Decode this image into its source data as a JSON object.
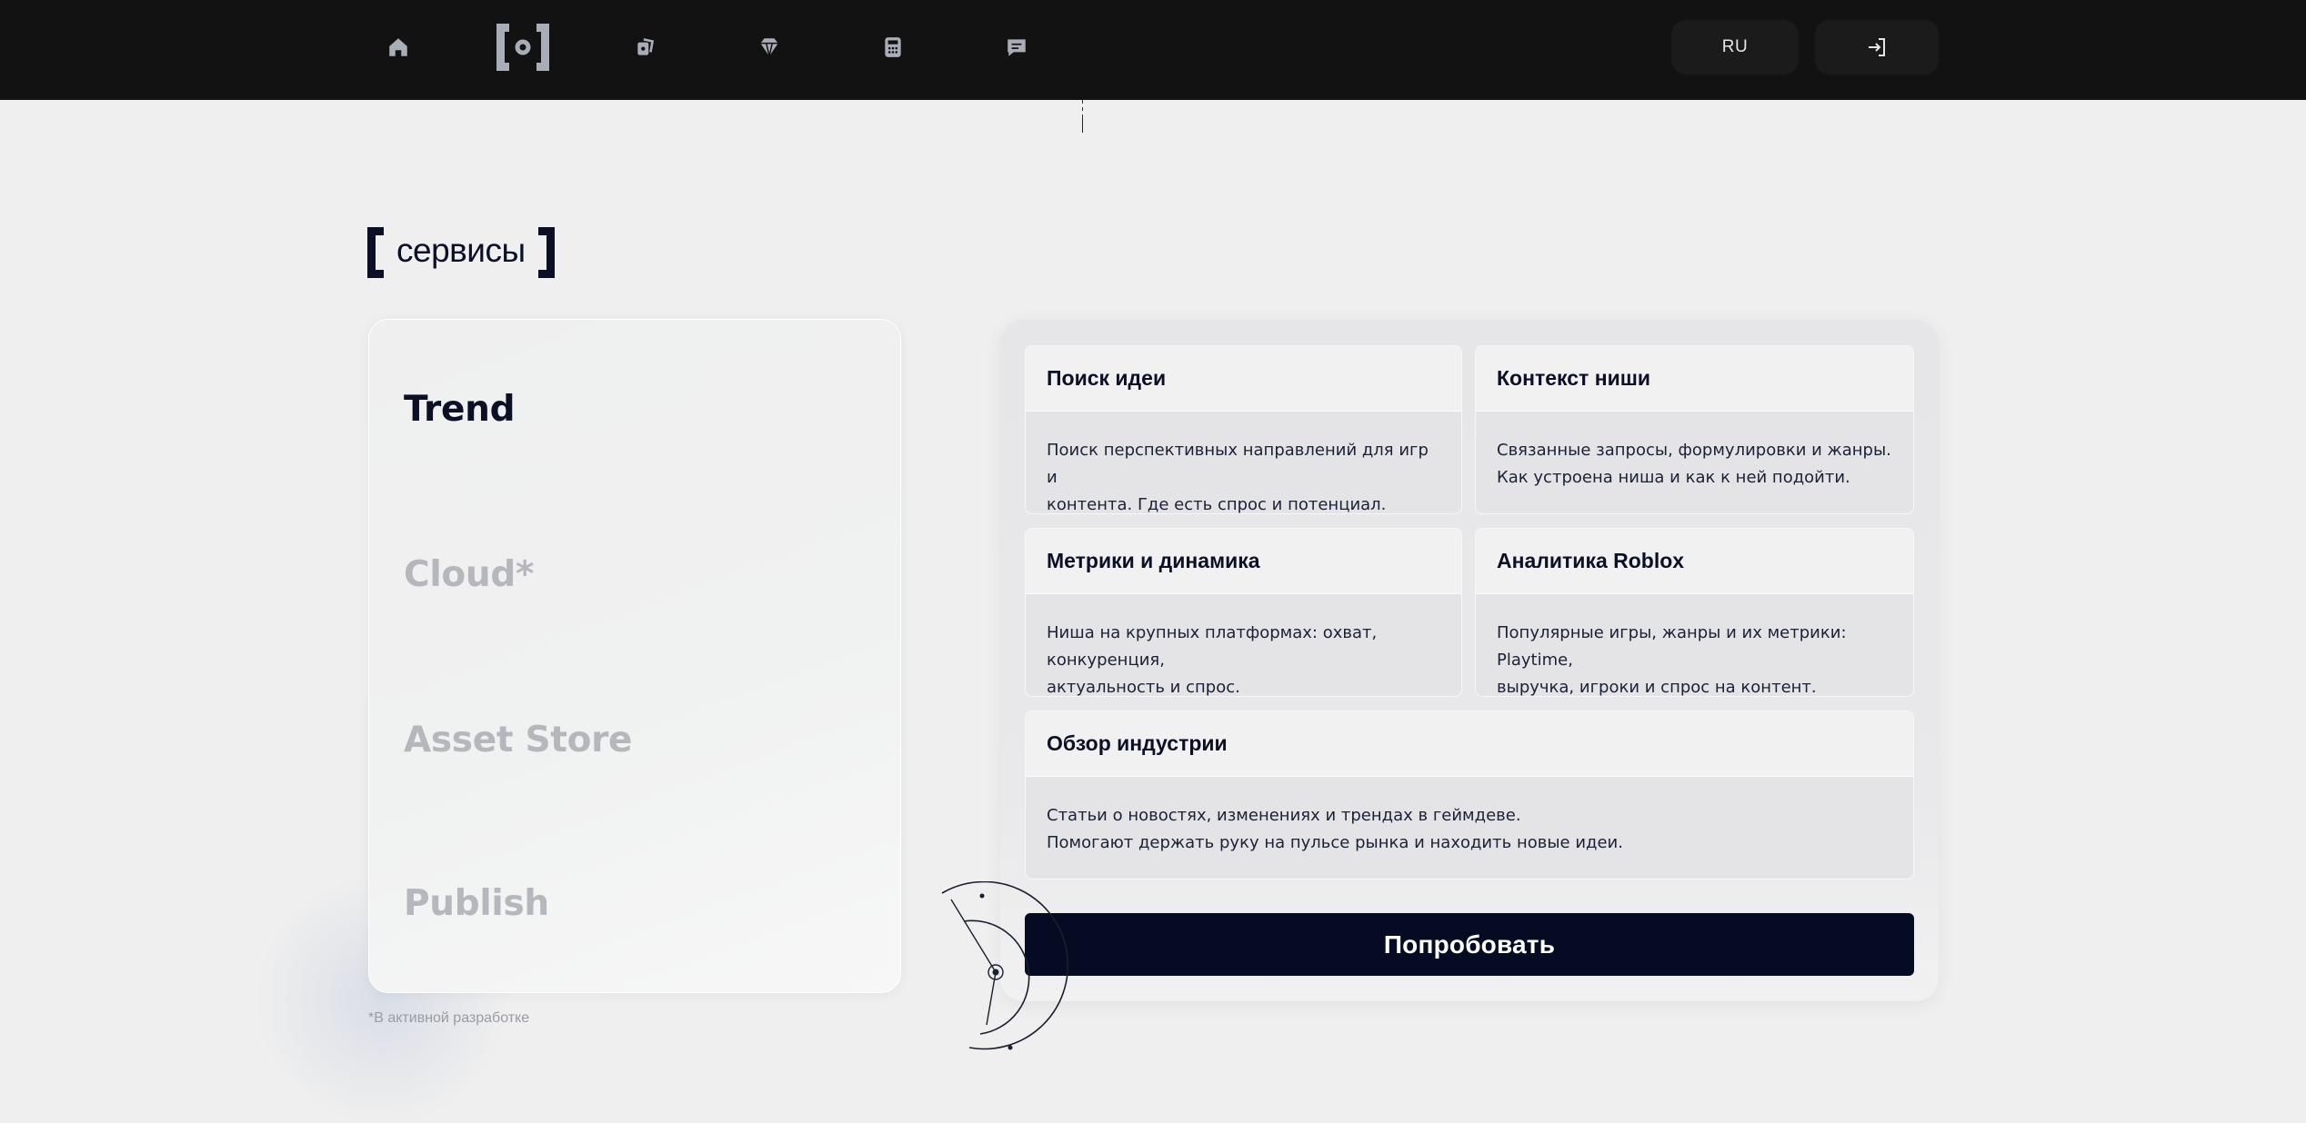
{
  "nav": {
    "items": [
      {
        "icon": "home-icon"
      },
      {
        "icon": "logo-icon"
      },
      {
        "icon": "cards-icon"
      },
      {
        "icon": "diamond-icon"
      },
      {
        "icon": "calculator-icon"
      },
      {
        "icon": "chat-icon"
      }
    ],
    "lang_label": "RU",
    "login_icon": "login-icon"
  },
  "section": {
    "title": "сервисы"
  },
  "left_panel": {
    "items": [
      {
        "label": "Trend",
        "state": "active"
      },
      {
        "label": "Cloud*",
        "state": "inactive"
      },
      {
        "label": "Asset Store",
        "state": "inactive"
      },
      {
        "label": "Publish",
        "state": "inactive"
      }
    ],
    "note": "*В активной разработке"
  },
  "cards": [
    {
      "title": "Поиск идеи",
      "lines": [
        "Поиск перспективных направлений для игр и",
        "контента. Где есть спрос и потенциал."
      ]
    },
    {
      "title": "Контекст ниши",
      "lines": [
        "Связанные запросы, формулировки и жанры.",
        "Как устроена ниша и как к ней подойти."
      ]
    },
    {
      "title": "Метрики и динамика",
      "lines": [
        "Ниша на крупных платформах: охват, конкуренция,",
        "актуальность и спрос."
      ]
    },
    {
      "title": "Аналитика Roblox",
      "lines": [
        "Популярные игры, жанры и их метрики: Playtime,",
        "выручка, игроки и спрос на контент."
      ]
    },
    {
      "title": "Обзор индустрии",
      "lines": [
        "Статьи о новостях, изменениях и трендах в геймдеве.",
        "Помогают держать руку на пульсе рынка и находить новые идеи."
      ]
    }
  ],
  "cta": {
    "label": "Попробовать"
  },
  "colors": {
    "topbar": "#121212",
    "accent_dark": "#040b22",
    "inactive_text": "#b6b7bd"
  }
}
